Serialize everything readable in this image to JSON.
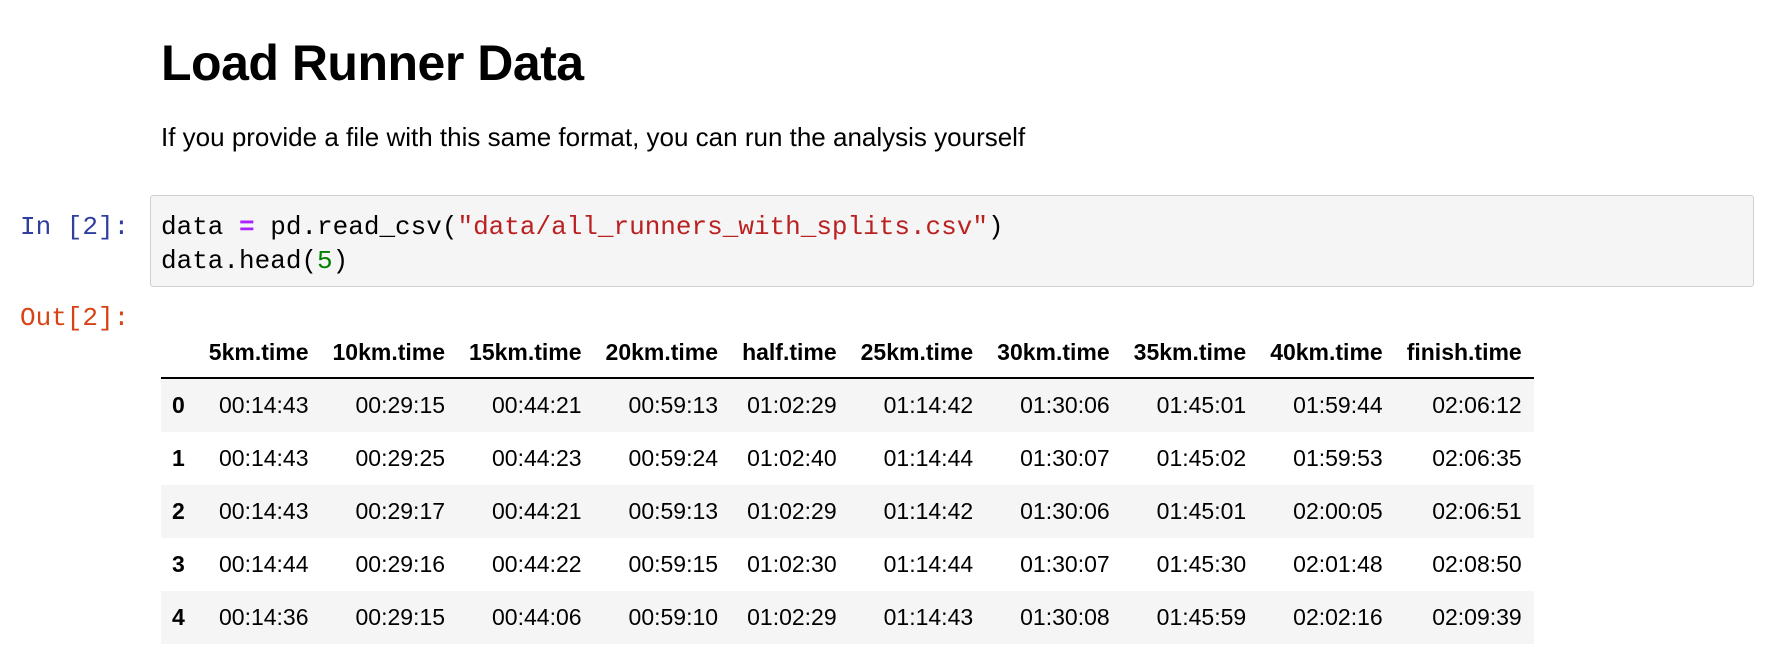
{
  "markdown": {
    "title": "Load Runner Data",
    "text": "If you provide a file with this same format, you can run the analysis yourself"
  },
  "cell": {
    "in_prompt": "In [2]:",
    "out_prompt": "Out[2]:",
    "code": {
      "line1": {
        "var": "data ",
        "op": "=",
        "call": " pd.read_csv(",
        "str": "\"data/all_runners_with_splits.csv\"",
        "close": ")"
      },
      "line2": {
        "call": "data.head(",
        "num": "5",
        "close": ")"
      }
    }
  },
  "table": {
    "index_header": "",
    "columns": [
      "5km.time",
      "10km.time",
      "15km.time",
      "20km.time",
      "half.time",
      "25km.time",
      "30km.time",
      "35km.time",
      "40km.time",
      "finish.time"
    ],
    "rows": [
      {
        "index": "0",
        "values": [
          "00:14:43",
          "00:29:15",
          "00:44:21",
          "00:59:13",
          "01:02:29",
          "01:14:42",
          "01:30:06",
          "01:45:01",
          "01:59:44",
          "02:06:12"
        ]
      },
      {
        "index": "1",
        "values": [
          "00:14:43",
          "00:29:25",
          "00:44:23",
          "00:59:24",
          "01:02:40",
          "01:14:44",
          "01:30:07",
          "01:45:02",
          "01:59:53",
          "02:06:35"
        ]
      },
      {
        "index": "2",
        "values": [
          "00:14:43",
          "00:29:17",
          "00:44:21",
          "00:59:13",
          "01:02:29",
          "01:14:42",
          "01:30:06",
          "01:45:01",
          "02:00:05",
          "02:06:51"
        ]
      },
      {
        "index": "3",
        "values": [
          "00:14:44",
          "00:29:16",
          "00:44:22",
          "00:59:15",
          "01:02:30",
          "01:14:44",
          "01:30:07",
          "01:45:30",
          "02:01:48",
          "02:08:50"
        ]
      },
      {
        "index": "4",
        "values": [
          "00:14:36",
          "00:29:15",
          "00:44:06",
          "00:59:10",
          "01:02:29",
          "01:14:43",
          "01:30:08",
          "01:45:59",
          "02:02:16",
          "02:09:39"
        ]
      }
    ]
  },
  "colors": {
    "in_prompt": "#303f9f",
    "out_prompt": "#d84315",
    "code_bg": "#f5f5f5",
    "string": "#ba2121",
    "number": "#008000",
    "operator": "#aa22ff"
  }
}
